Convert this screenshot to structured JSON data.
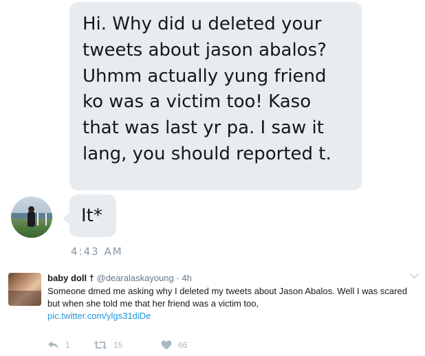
{
  "dm": {
    "message_lines": [
      "Hi. Why did u deleted your",
      "tweets about jason abalos?",
      "Uhmm actually yung friend",
      "ko was a victim too! Kaso",
      "that was last yr pa. I saw it",
      "lang, you should reported t."
    ],
    "short_message": "It*",
    "timestamp": "4:43 AM",
    "avatar_icon": "profile-photo"
  },
  "tweet": {
    "display_name": "baby doll †",
    "handle": "@dearalaskayoung",
    "separator": "·",
    "time": "4h",
    "text": "Someone dmed me asking why I deleted my tweets about Jason Abalos. Well I was scared but when she told me that her friend was a victim too,",
    "link": "pic.twitter.com/ylgs31diDe",
    "actions": {
      "reply_count": "1",
      "retweet_count": "15",
      "like_count": "66"
    },
    "colors": {
      "link": "#1b95e0",
      "muted": "#657786",
      "icon": "#aab8c2",
      "bubble": "#e6ecf0"
    }
  }
}
